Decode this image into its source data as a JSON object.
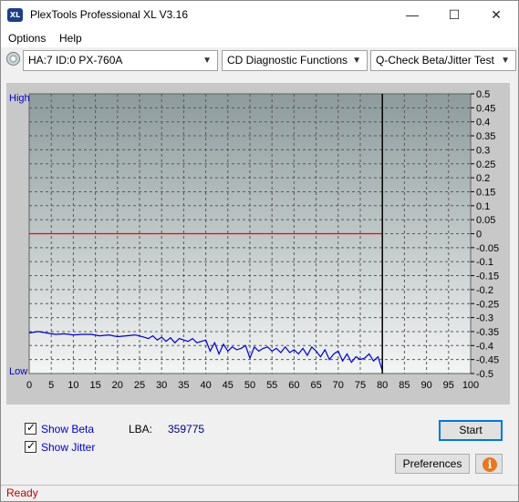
{
  "window": {
    "title": "PlexTools Professional XL V3.16",
    "icon_text": "XL",
    "minimize": "—",
    "maximize": "☐",
    "close": "✕"
  },
  "menu": {
    "options": "Options",
    "help": "Help"
  },
  "toolbar": {
    "drive": "HA:7 ID:0  PX-760A",
    "function": "CD Diagnostic Functions",
    "test": "Q-Check Beta/Jitter Test"
  },
  "chart_data": {
    "type": "line",
    "left_labels": {
      "high": "High",
      "low": "Low"
    },
    "x_ticks": [
      0,
      5,
      10,
      15,
      20,
      25,
      30,
      35,
      40,
      45,
      50,
      55,
      60,
      65,
      70,
      75,
      80,
      85,
      90,
      95,
      100
    ],
    "y_ticks": [
      "0.5",
      "0.45",
      "0.4",
      "0.35",
      "0.3",
      "0.25",
      "0.2",
      "0.15",
      "0.1",
      "0.05",
      "0",
      "-0.05",
      "-0.1",
      "-0.15",
      "-0.2",
      "-0.25",
      "-0.3",
      "-0.35",
      "-0.4",
      "-0.45",
      "-0.5"
    ],
    "xlim": [
      0,
      100
    ],
    "ylim": [
      -0.5,
      0.5
    ],
    "grid": true,
    "end_marker_x": 80,
    "series": [
      {
        "color": "#ff0000",
        "x": [
          0,
          80
        ],
        "y": [
          0.0,
          0.0
        ]
      },
      {
        "color": "#0000cc",
        "x": [
          0,
          2,
          4,
          6,
          8,
          10,
          12,
          14,
          16,
          18,
          20,
          22,
          24,
          26,
          27,
          28,
          29,
          30,
          31,
          32,
          33,
          34,
          35,
          36,
          37,
          38,
          39,
          40,
          41,
          42,
          43,
          44,
          45,
          46,
          47,
          48,
          49,
          50,
          51,
          52,
          53,
          54,
          55,
          56,
          57,
          58,
          59,
          60,
          61,
          62,
          63,
          64,
          65,
          66,
          67,
          68,
          69,
          70,
          71,
          72,
          73,
          74,
          75,
          76,
          77,
          78,
          79,
          80
        ],
        "y": [
          -0.355,
          -0.35,
          -0.355,
          -0.36,
          -0.358,
          -0.362,
          -0.36,
          -0.36,
          -0.365,
          -0.362,
          -0.368,
          -0.365,
          -0.362,
          -0.37,
          -0.375,
          -0.365,
          -0.38,
          -0.37,
          -0.385,
          -0.372,
          -0.39,
          -0.375,
          -0.38,
          -0.385,
          -0.375,
          -0.39,
          -0.385,
          -0.38,
          -0.42,
          -0.39,
          -0.43,
          -0.395,
          -0.42,
          -0.405,
          -0.415,
          -0.41,
          -0.4,
          -0.445,
          -0.405,
          -0.42,
          -0.41,
          -0.405,
          -0.42,
          -0.41,
          -0.425,
          -0.405,
          -0.425,
          -0.415,
          -0.43,
          -0.41,
          -0.435,
          -0.405,
          -0.42,
          -0.44,
          -0.415,
          -0.45,
          -0.43,
          -0.42,
          -0.455,
          -0.43,
          -0.46,
          -0.44,
          -0.45,
          -0.445,
          -0.43,
          -0.455,
          -0.44,
          -0.49
        ]
      }
    ]
  },
  "controls": {
    "show_beta": "Show Beta",
    "show_jitter": "Show Jitter",
    "lba_label": "LBA:",
    "lba_value": "359775",
    "start": "Start",
    "preferences": "Preferences",
    "info_icon": "i"
  },
  "status": {
    "text": "Ready"
  }
}
